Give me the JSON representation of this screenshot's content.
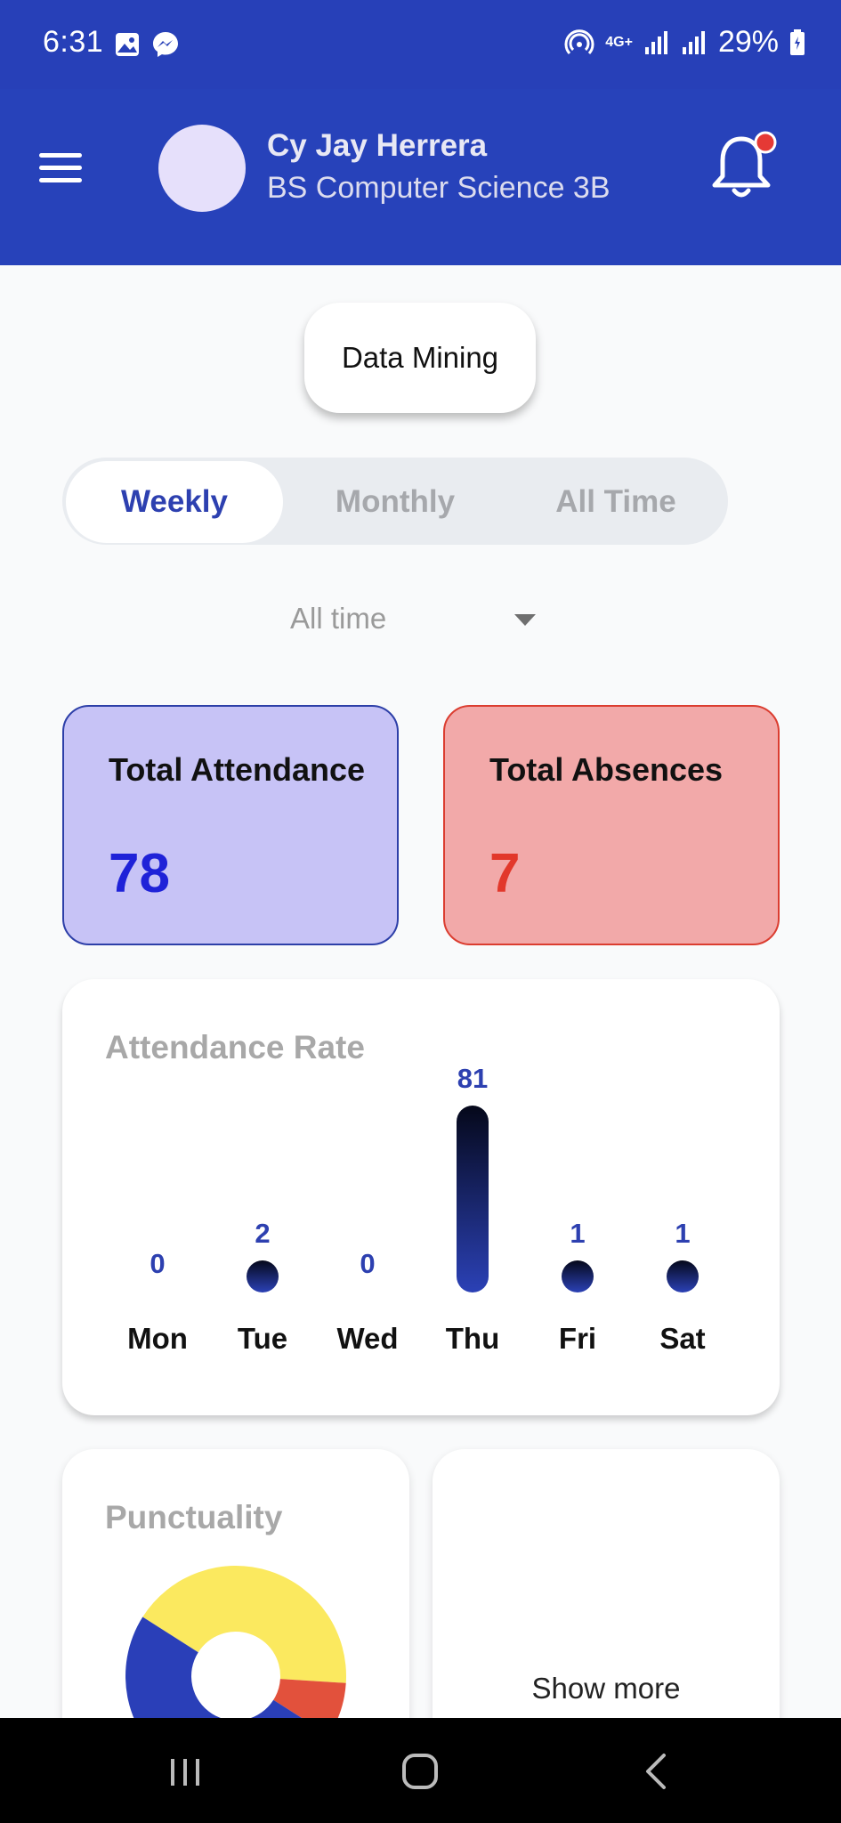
{
  "status_bar": {
    "time": "6:31",
    "battery": "29%",
    "network": "4G+"
  },
  "header": {
    "user_name": "Cy Jay Herrera",
    "course": "BS Computer Science 3B",
    "notification_dot_color": "#e53935"
  },
  "subject": {
    "label": "Data Mining"
  },
  "period_tabs": [
    {
      "label": "Weekly",
      "active": true
    },
    {
      "label": "Monthly",
      "active": false
    },
    {
      "label": "All Time",
      "active": false
    }
  ],
  "filter": {
    "selected": "All time"
  },
  "stats": {
    "attendance": {
      "label": "Total Attendance",
      "value": "78"
    },
    "absences": {
      "label": "Total Absences",
      "value": "7"
    }
  },
  "attendance_rate": {
    "title": "Attendance Rate"
  },
  "chart_data": {
    "type": "bar",
    "title": "Attendance Rate",
    "categories": [
      "Mon",
      "Tue",
      "Wed",
      "Thu",
      "Fri",
      "Sat"
    ],
    "values": [
      0,
      2,
      0,
      81,
      1,
      1
    ],
    "gradient_top": "#05081a",
    "gradient_bottom": "#2b41b6"
  },
  "punctuality": {
    "title": "Punctuality",
    "segments": [
      {
        "color": "#fbe95f",
        "fraction": 0.42
      },
      {
        "color": "#e2513c",
        "fraction": 0.08
      },
      {
        "color": "#2a3fb8",
        "fraction": 0.5
      }
    ]
  },
  "more": {
    "label": "Show more"
  },
  "colors": {
    "primary": "#2740b8",
    "attendance_card": "#c7c3f6",
    "absence_card": "#f2a9a9"
  }
}
